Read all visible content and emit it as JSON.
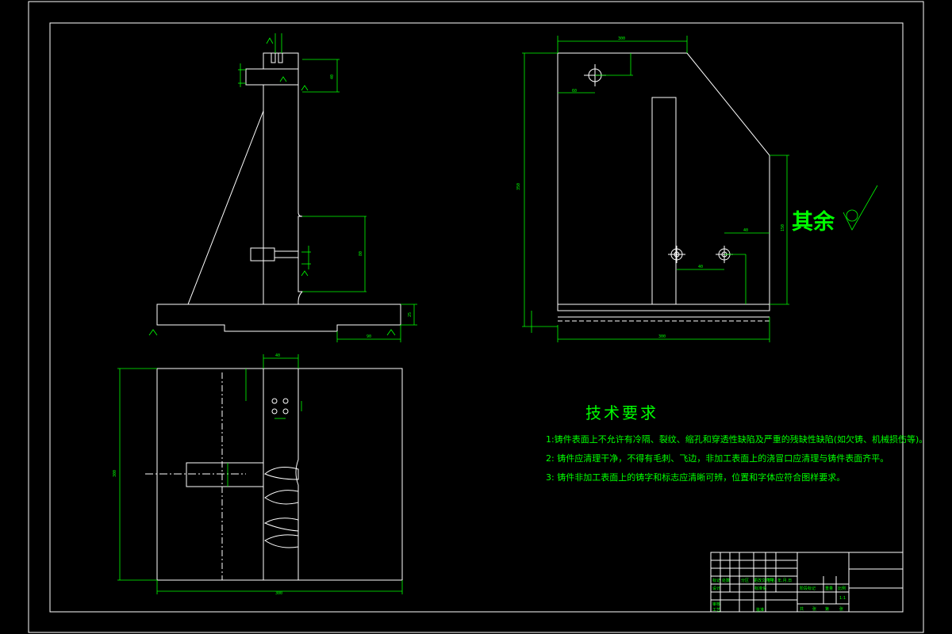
{
  "drawing": {
    "surface_finish_note": "其余",
    "tech_requirements": {
      "title": "技术要求",
      "items": [
        "1:铸件表面上不允许有冷隔、裂纹、缩孔和穿透性缺陷及严重的残缺性缺陷(如欠铸、机械损伤等)。",
        "2: 铸件应清理干净，不得有毛刺、飞边，非加工表面上的浇冒口应清理与铸件表面齐平。",
        "3: 铸件非加工表面上的铸字和标志应清晰可辨，位置和字体应符合图样要求。"
      ]
    },
    "title_block": {
      "row1": [
        "标记",
        "处数",
        "分区",
        "更改文件号",
        "签名",
        "年.月.日"
      ],
      "row2": [
        "设计",
        "",
        "",
        "标准化",
        ""
      ],
      "row3": [
        "审核",
        ""
      ],
      "row4": [
        "工艺",
        "",
        "批准"
      ],
      "stage_header": [
        "阶段标记",
        "重量",
        "比例"
      ],
      "scale": "1:1",
      "sheet": [
        "共",
        "张",
        "第",
        "张"
      ]
    }
  },
  "colors": {
    "background": "#000000",
    "outline": "#ffffff",
    "dimension": "#00ff00"
  }
}
